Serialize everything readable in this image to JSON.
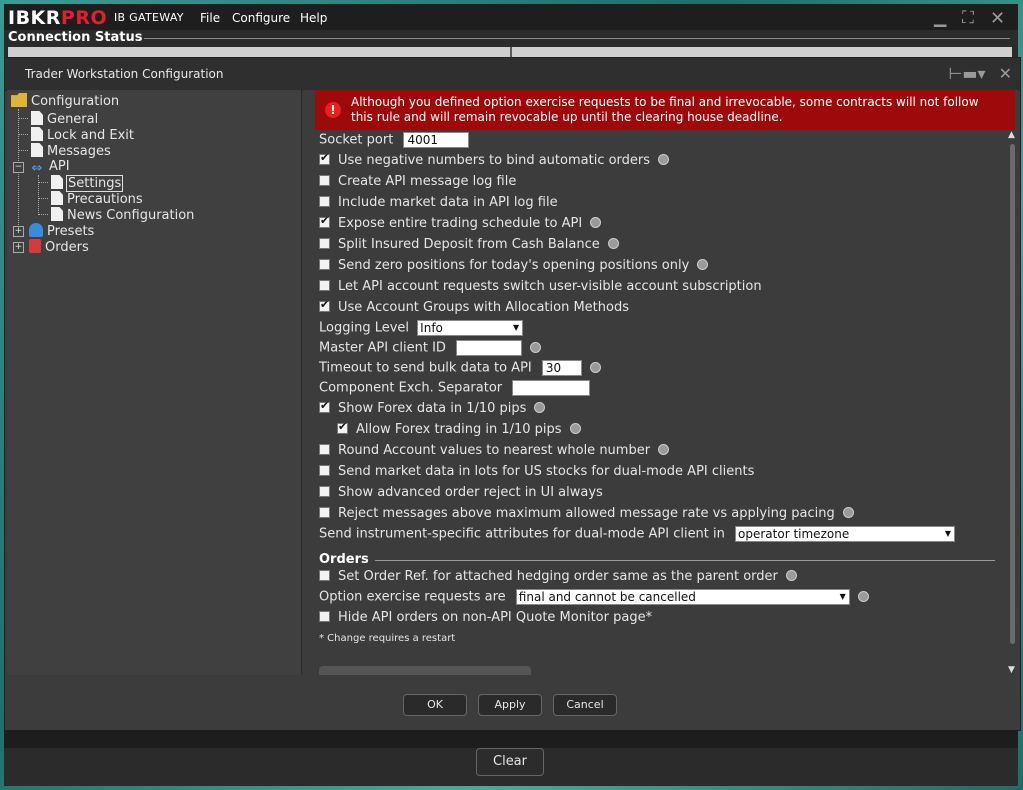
{
  "gateway": {
    "logo_main": "IBKR",
    "logo_accent": "PRO",
    "app_name": "IB GATEWAY",
    "menu": [
      "File",
      "Configure",
      "Help"
    ],
    "connection_status_label": "Connection Status",
    "clear_label": "Clear"
  },
  "dialog": {
    "title": "Trader Workstation Configuration",
    "alert": "Although you defined option exercise requests to be final and irrevocable, some contracts will not follow this rule and will remain revocable up until the clearing house deadline.",
    "ok_label": "OK",
    "apply_label": "Apply",
    "cancel_label": "Cancel"
  },
  "tree": {
    "root": "Configuration",
    "general": "General",
    "lock_exit": "Lock and Exit",
    "messages": "Messages",
    "api": "API",
    "settings": "Settings",
    "precautions": "Precautions",
    "news_config": "News Configuration",
    "presets": "Presets",
    "orders": "Orders"
  },
  "settings": {
    "socket_port_label": "Socket port",
    "socket_port_value": "4001",
    "opt_negative_numbers": "Use negative numbers to bind automatic orders",
    "opt_log_file": "Create API message log file",
    "opt_market_data_log": "Include market data in API log file",
    "opt_trading_schedule": "Expose entire trading schedule to API",
    "opt_split_deposit": "Split Insured Deposit from Cash Balance",
    "opt_zero_positions": "Send zero positions for today's opening positions only",
    "opt_account_switch": "Let API account requests switch user-visible account subscription",
    "opt_account_groups": "Use Account Groups with Allocation Methods",
    "logging_level_label": "Logging Level",
    "logging_level_value": "Info",
    "master_client_label": "Master API client ID",
    "master_client_value": "",
    "timeout_label": "Timeout to send bulk data to API",
    "timeout_value": "30",
    "component_sep_label": "Component Exch. Separator",
    "component_sep_value": "",
    "opt_forex_data": "Show Forex data in 1/10 pips",
    "opt_forex_trading": "Allow Forex trading in 1/10 pips",
    "opt_round_account": "Round Account values to nearest whole number",
    "opt_lots": "Send market data in lots for US stocks for dual-mode API clients",
    "opt_order_reject": "Show advanced order reject in UI always",
    "opt_reject_messages": "Reject messages above maximum allowed message rate vs applying pacing",
    "attributes_label": "Send instrument-specific attributes for dual-mode API client in",
    "attributes_value": "operator timezone",
    "orders_section": "Orders",
    "opt_order_ref": "Set Order Ref. for attached hedging order same as the parent order",
    "exercise_label": "Option exercise requests are",
    "exercise_value": "final and cannot be cancelled",
    "opt_hide_api_orders": "Hide API orders on non-API Quote Monitor page*",
    "restart_note": "* Change requires a restart"
  },
  "colors": {
    "alert_bg": "#9e0a0a",
    "logo_accent": "#e0202b",
    "panel_bg": "#3c3c3c"
  }
}
